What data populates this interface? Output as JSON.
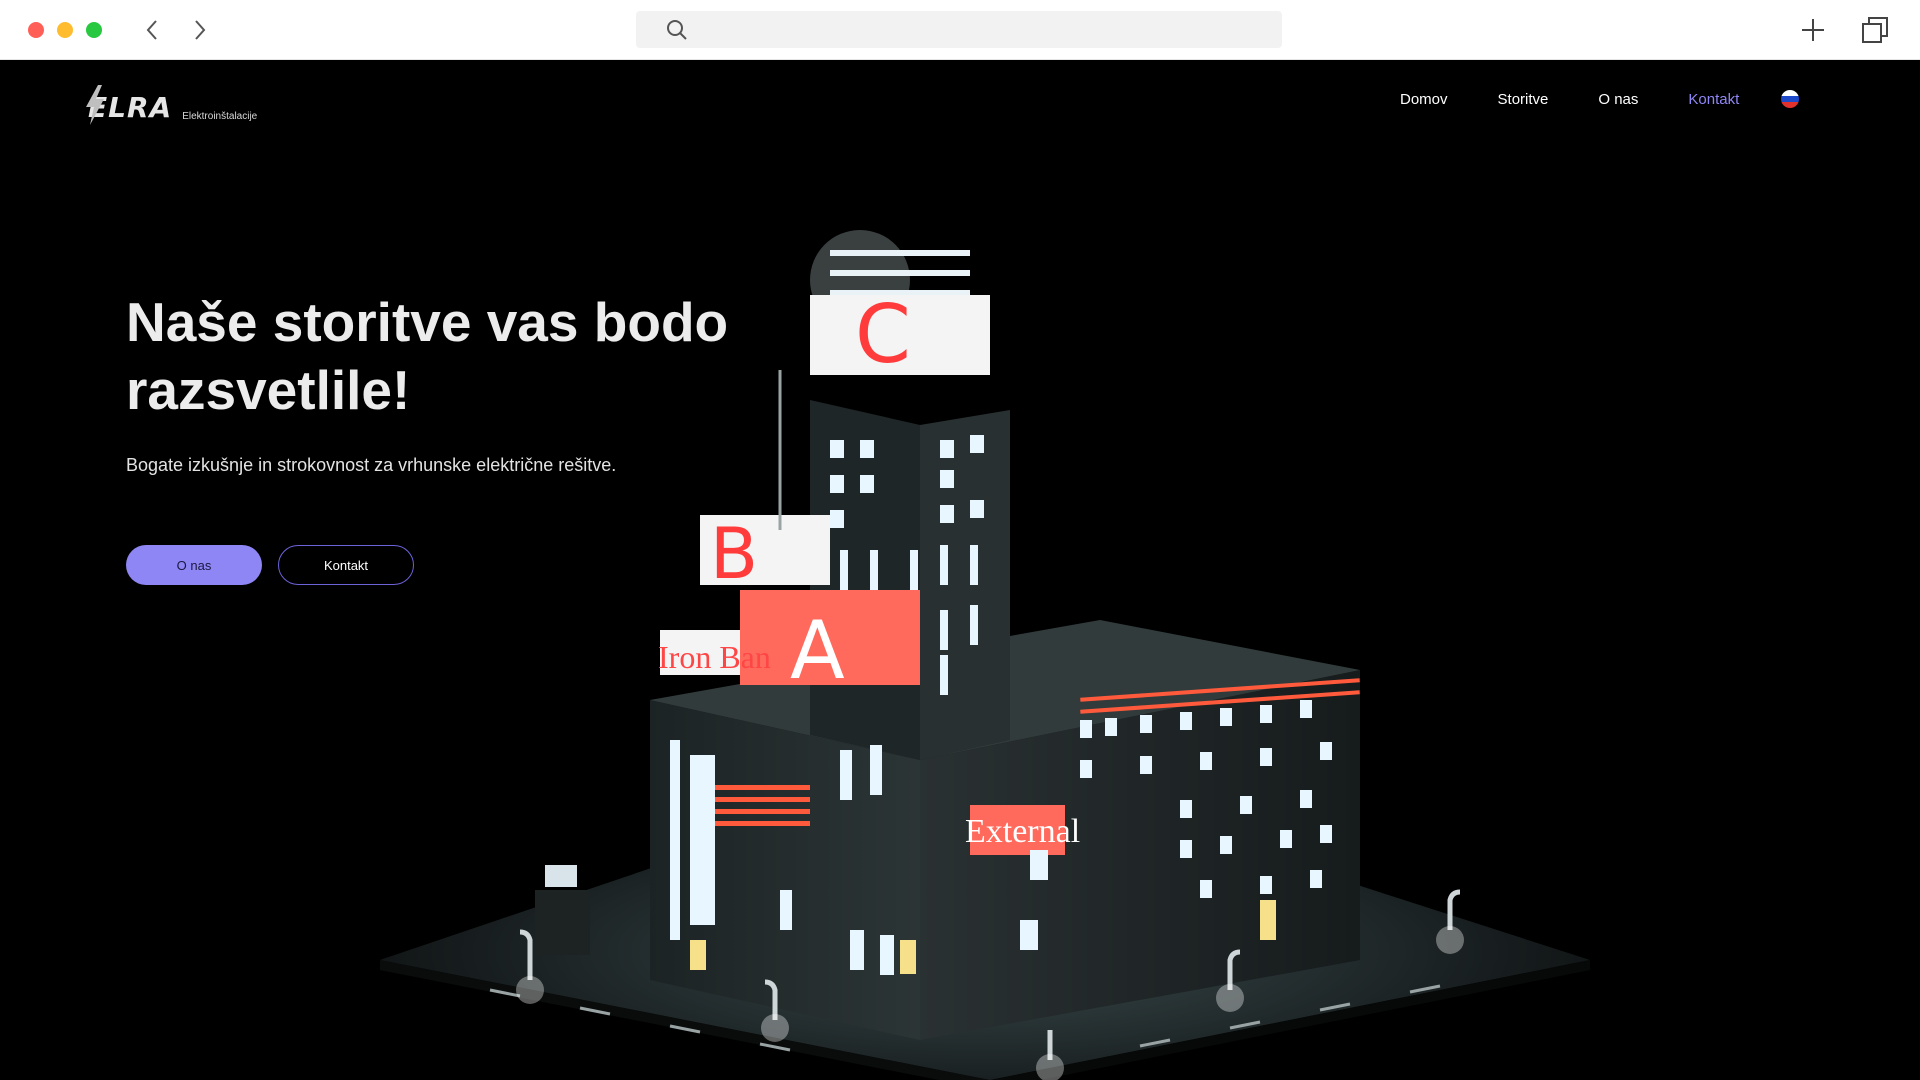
{
  "browser": {
    "url_value": "",
    "icons": [
      "chevron-left-icon",
      "chevron-right-icon",
      "search-icon",
      "plus-icon",
      "tabs-icon"
    ]
  },
  "site": {
    "logo": {
      "mark": "ELRA",
      "subtitle": "Elektroinštalacije"
    },
    "nav": {
      "items": [
        {
          "label": "Domov",
          "active": false
        },
        {
          "label": "Storitve",
          "active": false
        },
        {
          "label": "O nas",
          "active": false
        },
        {
          "label": "Kontakt",
          "active": true
        }
      ],
      "language_icon": "slovenia-flag-icon"
    },
    "hero": {
      "title": "Naše storitve vas bodo razsvetlile!",
      "subtitle": "Bogate izkušnje in strokovnost za vrhunske električne rešitve.",
      "primary_button": "O nas",
      "secondary_button": "Kontakt"
    },
    "illustration": {
      "signs": [
        "C",
        "B",
        "A",
        "Iron Ban",
        "External"
      ]
    }
  },
  "colors": {
    "accent": "#8f86f5",
    "background": "#000000",
    "neon_red": "#ff3b3b",
    "window_glow": "#e8f6ff"
  }
}
